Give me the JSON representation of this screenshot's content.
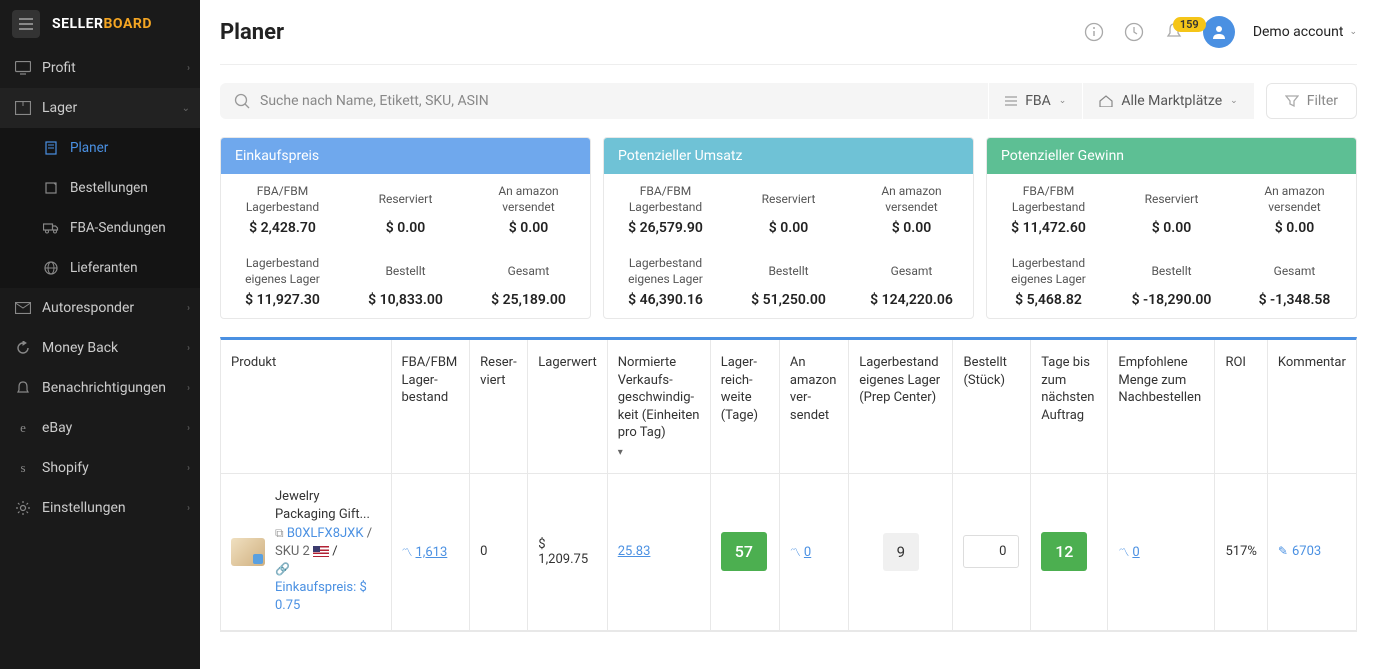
{
  "brand": {
    "part1": "SELLER",
    "part2": "BOARD"
  },
  "sidebar": {
    "items": [
      {
        "label": "Profit"
      },
      {
        "label": "Lager"
      },
      {
        "label": "Autoresponder"
      },
      {
        "label": "Money Back"
      },
      {
        "label": "Benachrichtigungen"
      },
      {
        "label": "eBay"
      },
      {
        "label": "Shopify"
      },
      {
        "label": "Einstellungen"
      }
    ],
    "lager_sub": [
      {
        "label": "Planer"
      },
      {
        "label": "Bestellungen"
      },
      {
        "label": "FBA-Sendungen"
      },
      {
        "label": "Lieferanten"
      }
    ]
  },
  "header": {
    "title": "Planer",
    "notifications": "159",
    "account": "Demo account"
  },
  "filters": {
    "search_placeholder": "Suche nach Name, Etikett, SKU, ASIN",
    "fba": "FBA",
    "marketplace": "Alle Marktplätze",
    "filter_btn": "Filter"
  },
  "cards": [
    {
      "title": "Einkaufspreis",
      "metrics": [
        {
          "label": "FBA/FBM Lagerbestand",
          "value": "$ 2,428.70"
        },
        {
          "label": "Reserviert",
          "value": "$ 0.00"
        },
        {
          "label": "An amazon versendet",
          "value": "$ 0.00"
        },
        {
          "label": "Lagerbestand eigenes Lager",
          "value": "$ 11,927.30"
        },
        {
          "label": "Bestellt",
          "value": "$ 10,833.00"
        },
        {
          "label": "Gesamt",
          "value": "$ 25,189.00"
        }
      ]
    },
    {
      "title": "Potenzieller Umsatz",
      "metrics": [
        {
          "label": "FBA/FBM Lagerbestand",
          "value": "$ 26,579.90"
        },
        {
          "label": "Reserviert",
          "value": "$ 0.00"
        },
        {
          "label": "An amazon versendet",
          "value": "$ 0.00"
        },
        {
          "label": "Lagerbestand eigenes Lager",
          "value": "$ 46,390.16"
        },
        {
          "label": "Bestellt",
          "value": "$ 51,250.00"
        },
        {
          "label": "Gesamt",
          "value": "$ 124,220.06"
        }
      ]
    },
    {
      "title": "Potenzieller Gewinn",
      "metrics": [
        {
          "label": "FBA/FBM Lagerbestand",
          "value": "$ 11,472.60"
        },
        {
          "label": "Reserviert",
          "value": "$ 0.00"
        },
        {
          "label": "An amazon versendet",
          "value": "$ 0.00"
        },
        {
          "label": "Lagerbestand eigenes Lager",
          "value": "$ 5,468.82"
        },
        {
          "label": "Bestellt",
          "value": "$ -18,290.00"
        },
        {
          "label": "Gesamt",
          "value": "$ -1,348.58"
        }
      ]
    }
  ],
  "table": {
    "columns": [
      "Produkt",
      "FBA/FBM Lager­bestand",
      "Reser­viert",
      "Lagerwert",
      "Normierte Verkaufs­geschwindig­keit (Einheiten pro Tag)",
      "Lager­reich­weite (Tage)",
      "An amazon ver­sendet",
      "Lagerbestand eigenes Lager (Prep Center)",
      "Bestellt (Stück)",
      "Tage bis zum nächsten Auftrag",
      "Empfohlene Menge zum Nachbestellen",
      "ROI",
      "Kommentar"
    ],
    "row": {
      "product": {
        "title": "Jewelry Packaging Gift...",
        "asin": "B0XLFX8JXK",
        "sku": "SKU 2",
        "price_label": "Einkaufspreis: $ 0.75"
      },
      "fba_stock": "1,613",
      "reserved": "0",
      "stock_value": "$ 1,209.75",
      "velocity": "25.83",
      "days_stock": "57",
      "sent_amazon": "0",
      "own_warehouse": "9",
      "ordered": "0",
      "days_next_order": "12",
      "recommended_qty": "0",
      "roi": "517%",
      "comment": "6703"
    },
    "asin_sep": " / "
  }
}
